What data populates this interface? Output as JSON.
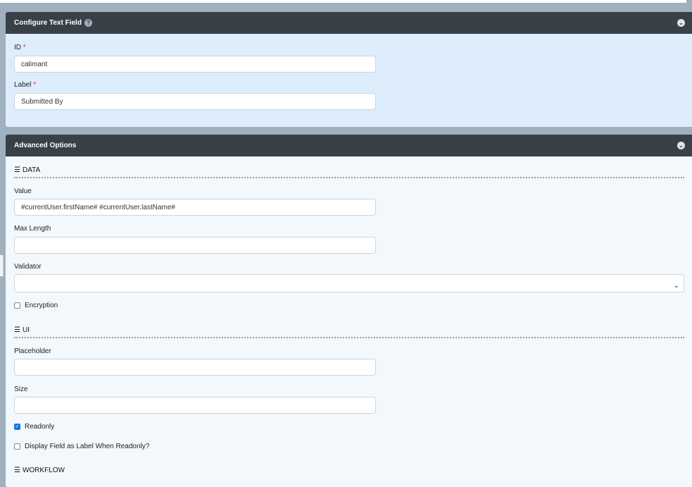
{
  "configure": {
    "title": "Configure Text Field",
    "id_label": "ID",
    "id_value": "calimant",
    "label_label": "Label",
    "label_value": "Submitted By",
    "required_mark": "*"
  },
  "advanced": {
    "title": "Advanced Options",
    "data_section": "DATA",
    "value_label": "Value",
    "value_value": "#currentUser.firstName# #currentUser.lastName#",
    "maxlength_label": "Max Length",
    "maxlength_value": "",
    "validator_label": "Validator",
    "validator_value": "",
    "encryption_label": "Encryption",
    "encryption_checked": false,
    "ui_section": "UI",
    "placeholder_label": "Placeholder",
    "placeholder_value": "",
    "size_label": "Size",
    "size_value": "",
    "readonly_label": "Readonly",
    "readonly_checked": true,
    "display_label_readonly": "Display Field as Label When Readonly?",
    "display_label_checked": false,
    "workflow_section": "WORKFLOW"
  }
}
